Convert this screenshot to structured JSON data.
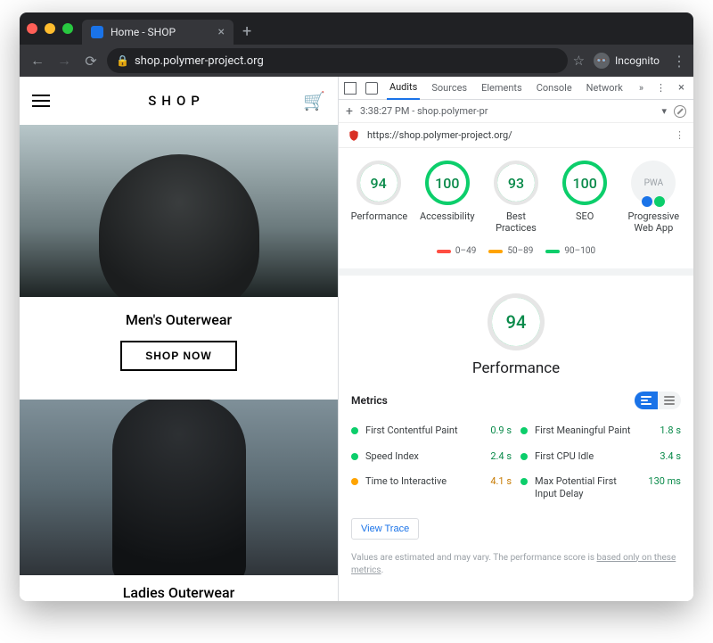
{
  "browser": {
    "tab_title": "Home - SHOP",
    "address": "shop.polymer-project.org",
    "incognito_label": "Incognito"
  },
  "site": {
    "brand": "SHOP",
    "category1": "Men's Outerwear",
    "shop_now": "SHOP NOW",
    "category2": "Ladies Outerwear"
  },
  "devtools": {
    "tabs": [
      "Audits",
      "Sources",
      "Elements",
      "Console",
      "Network"
    ],
    "active_tab": "Audits",
    "run_time": "3:38:27 PM - shop.polymer-pr",
    "audit_url": "https://shop.polymer-project.org/",
    "scores": [
      {
        "value": 94,
        "label": "Performance",
        "partial": true
      },
      {
        "value": 100,
        "label": "Accessibility",
        "partial": false
      },
      {
        "value": 93,
        "label": "Best Practices",
        "partial": true
      },
      {
        "value": 100,
        "label": "SEO",
        "partial": false
      }
    ],
    "pwa_label": "Progressive Web App",
    "legend": [
      {
        "color": "#ff4e42",
        "range": "0–49"
      },
      {
        "color": "#ffa400",
        "range": "50–89"
      },
      {
        "color": "#0cce6b",
        "range": "90–100"
      }
    ],
    "big_score": {
      "value": 94,
      "label": "Performance"
    },
    "metrics_heading": "Metrics",
    "metrics": [
      {
        "name": "First Contentful Paint",
        "value": "0.9 s",
        "status": "g"
      },
      {
        "name": "First Meaningful Paint",
        "value": "1.8 s",
        "status": "g"
      },
      {
        "name": "Speed Index",
        "value": "2.4 s",
        "status": "g"
      },
      {
        "name": "First CPU Idle",
        "value": "3.4 s",
        "status": "g"
      },
      {
        "name": "Time to Interactive",
        "value": "4.1 s",
        "status": "o"
      },
      {
        "name": "Max Potential First Input Delay",
        "value": "130 ms",
        "status": "g"
      }
    ],
    "view_trace": "View Trace",
    "disclaimer_a": "Values are estimated and may vary. The performance score is ",
    "disclaimer_link": "based only on these metrics",
    "disclaimer_b": "."
  }
}
